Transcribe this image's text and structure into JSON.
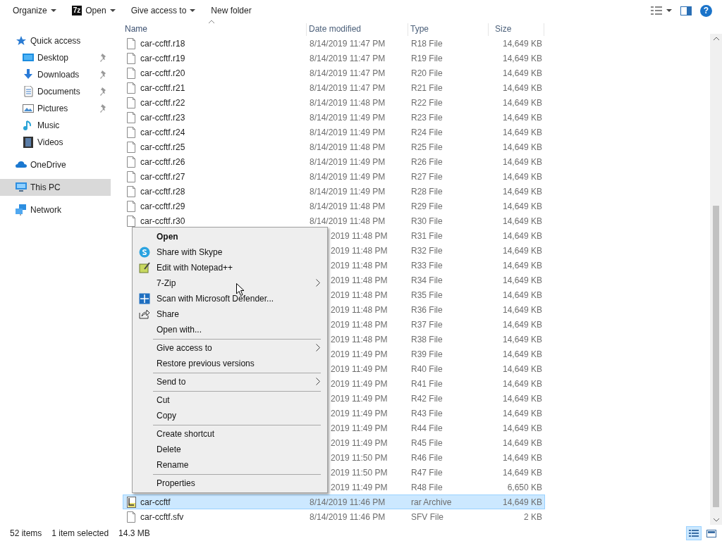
{
  "toolbar": {
    "items": [
      {
        "kind": "dropdown",
        "label": "Organize"
      },
      {
        "kind": "app-dropdown",
        "label": "Open",
        "icon_text": "7z"
      },
      {
        "kind": "dropdown",
        "label": "Give access to"
      },
      {
        "kind": "button",
        "label": "New folder"
      }
    ],
    "help": "?"
  },
  "sidebar": {
    "items": [
      {
        "label": "Quick access",
        "selected": false,
        "children": [
          {
            "label": "Desktop",
            "pinned": true,
            "selected": false
          },
          {
            "label": "Downloads",
            "pinned": true,
            "selected": false
          },
          {
            "label": "Documents",
            "pinned": true,
            "selected": false
          },
          {
            "label": "Pictures",
            "pinned": true,
            "selected": false
          },
          {
            "label": "Music",
            "pinned": false,
            "selected": false
          },
          {
            "label": "Videos",
            "pinned": false,
            "selected": false
          }
        ]
      },
      {
        "label": "OneDrive",
        "selected": false
      },
      {
        "label": "This PC",
        "selected": true
      },
      {
        "label": "Network",
        "selected": false
      }
    ]
  },
  "table": {
    "columns": [
      {
        "label": "Name",
        "sorted": true
      },
      {
        "label": "Date modified",
        "sorted": false
      },
      {
        "label": "Type",
        "sorted": false
      },
      {
        "label": "Size",
        "sorted": false
      }
    ],
    "rows": [
      {
        "name": "car-ccftf.r18",
        "date": "8/14/2019 11:47 PM",
        "type": "R18 File",
        "size": "14,649 KB",
        "selected": false
      },
      {
        "name": "car-ccftf.r19",
        "date": "8/14/2019 11:47 PM",
        "type": "R19 File",
        "size": "14,649 KB",
        "selected": false
      },
      {
        "name": "car-ccftf.r20",
        "date": "8/14/2019 11:47 PM",
        "type": "R20 File",
        "size": "14,649 KB",
        "selected": false
      },
      {
        "name": "car-ccftf.r21",
        "date": "8/14/2019 11:47 PM",
        "type": "R21 File",
        "size": "14,649 KB",
        "selected": false
      },
      {
        "name": "car-ccftf.r22",
        "date": "8/14/2019 11:48 PM",
        "type": "R22 File",
        "size": "14,649 KB",
        "selected": false
      },
      {
        "name": "car-ccftf.r23",
        "date": "8/14/2019 11:49 PM",
        "type": "R23 File",
        "size": "14,649 KB",
        "selected": false
      },
      {
        "name": "car-ccftf.r24",
        "date": "8/14/2019 11:49 PM",
        "type": "R24 File",
        "size": "14,649 KB",
        "selected": false
      },
      {
        "name": "car-ccftf.r25",
        "date": "8/14/2019 11:48 PM",
        "type": "R25 File",
        "size": "14,649 KB",
        "selected": false
      },
      {
        "name": "car-ccftf.r26",
        "date": "8/14/2019 11:49 PM",
        "type": "R26 File",
        "size": "14,649 KB",
        "selected": false
      },
      {
        "name": "car-ccftf.r27",
        "date": "8/14/2019 11:49 PM",
        "type": "R27 File",
        "size": "14,649 KB",
        "selected": false
      },
      {
        "name": "car-ccftf.r28",
        "date": "8/14/2019 11:49 PM",
        "type": "R28 File",
        "size": "14,649 KB",
        "selected": false
      },
      {
        "name": "car-ccftf.r29",
        "date": "8/14/2019 11:48 PM",
        "type": "R29 File",
        "size": "14,649 KB",
        "selected": false
      },
      {
        "name": "car-ccftf.r30",
        "date": "8/14/2019 11:48 PM",
        "type": "R30 File",
        "size": "14,649 KB",
        "selected": false
      },
      {
        "date": "2019 11:48 PM",
        "type": "R31 File",
        "size": "14,649 KB",
        "selected": false
      },
      {
        "date": "2019 11:48 PM",
        "type": "R32 File",
        "size": "14,649 KB",
        "selected": false
      },
      {
        "date": "2019 11:48 PM",
        "type": "R33 File",
        "size": "14,649 KB",
        "selected": false
      },
      {
        "date": "2019 11:48 PM",
        "type": "R34 File",
        "size": "14,649 KB",
        "selected": false
      },
      {
        "date": "2019 11:48 PM",
        "type": "R35 File",
        "size": "14,649 KB",
        "selected": false
      },
      {
        "date": "2019 11:48 PM",
        "type": "R36 File",
        "size": "14,649 KB",
        "selected": false
      },
      {
        "date": "2019 11:48 PM",
        "type": "R37 File",
        "size": "14,649 KB",
        "selected": false
      },
      {
        "date": "2019 11:48 PM",
        "type": "R38 File",
        "size": "14,649 KB",
        "selected": false
      },
      {
        "date": "2019 11:49 PM",
        "type": "R39 File",
        "size": "14,649 KB",
        "selected": false
      },
      {
        "date": "2019 11:49 PM",
        "type": "R40 File",
        "size": "14,649 KB",
        "selected": false
      },
      {
        "date": "2019 11:49 PM",
        "type": "R41 File",
        "size": "14,649 KB",
        "selected": false
      },
      {
        "date": "2019 11:49 PM",
        "type": "R42 File",
        "size": "14,649 KB",
        "selected": false
      },
      {
        "date": "2019 11:49 PM",
        "type": "R43 File",
        "size": "14,649 KB",
        "selected": false
      },
      {
        "date": "2019 11:49 PM",
        "type": "R44 File",
        "size": "14,649 KB",
        "selected": false
      },
      {
        "date": "2019 11:49 PM",
        "type": "R45 File",
        "size": "14,649 KB",
        "selected": false
      },
      {
        "date": "2019 11:50 PM",
        "type": "R46 File",
        "size": "14,649 KB",
        "selected": false
      },
      {
        "date": "2019 11:50 PM",
        "type": "R47 File",
        "size": "14,649 KB",
        "selected": false
      },
      {
        "date": "2019 11:49 PM",
        "type": "R48 File",
        "size": "6,650 KB",
        "selected": false
      },
      {
        "name": "car-ccftf",
        "date": "8/14/2019 11:46 PM",
        "type": "rar Archive",
        "size": "14,649 KB",
        "selected": true
      },
      {
        "name": "car-ccftf.sfv",
        "date": "8/14/2019 11:46 PM",
        "type": "SFV File",
        "size": "2 KB",
        "selected": false
      }
    ]
  },
  "context_menu": {
    "groups": [
      [
        {
          "label": "Open",
          "default": true,
          "submenu": false
        },
        {
          "label": "Share with Skype",
          "default": false,
          "submenu": false
        },
        {
          "label": "Edit with Notepad++",
          "default": false,
          "submenu": false
        },
        {
          "label": "7-Zip",
          "default": false,
          "submenu": true
        },
        {
          "label": "Scan with Microsoft Defender...",
          "default": false,
          "submenu": false
        },
        {
          "label": "Share",
          "default": false,
          "submenu": false
        },
        {
          "label": "Open with...",
          "default": false,
          "submenu": false
        }
      ],
      [
        {
          "label": "Give access to",
          "default": false,
          "submenu": true
        },
        {
          "label": "Restore previous versions",
          "default": false,
          "submenu": false
        }
      ],
      [
        {
          "label": "Send to",
          "default": false,
          "submenu": true
        }
      ],
      [
        {
          "label": "Cut",
          "default": false,
          "submenu": false
        },
        {
          "label": "Copy",
          "default": false,
          "submenu": false
        }
      ],
      [
        {
          "label": "Create shortcut",
          "default": false,
          "submenu": false
        },
        {
          "label": "Delete",
          "default": false,
          "submenu": false
        },
        {
          "label": "Rename",
          "default": false,
          "submenu": false
        }
      ],
      [
        {
          "label": "Properties",
          "default": false,
          "submenu": false
        }
      ]
    ]
  },
  "status_bar": {
    "item_count": "52 items",
    "selection": "1 item selected",
    "selection_size": "14.3 MB",
    "view_buttons": [
      {
        "selected": true
      },
      {
        "selected": false
      }
    ]
  }
}
